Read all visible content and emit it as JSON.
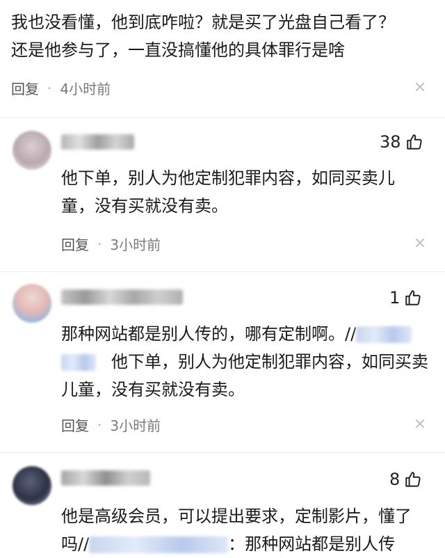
{
  "top_comment": {
    "text_line1": "我也没看懂，他到底咋啦？就是买了光盘自己看了？",
    "text_line2": "还是他参与了，一直没搞懂他的具体罪行是啥",
    "reply_label": "回复",
    "time": "4小时前"
  },
  "comments": [
    {
      "likes": "38",
      "text": "他下单，别人为他定制犯罪内容，如同买卖儿童，没有买就没有卖。",
      "reply_label": "回复",
      "time": "3小时前"
    },
    {
      "likes": "1",
      "text_part1": "那种网站都是别人传的，哪有定制啊。//",
      "text_part2": "他下单，别人为他定制犯罪内容，如同买卖儿童，没有买就没有卖。",
      "reply_label": "回复",
      "time": "3小时前"
    },
    {
      "likes": "8",
      "text_part1": "他是高级会员，可以提出要求，定制影片，懂了吗//",
      "text_part2": "：那种网站都是别人传"
    }
  ],
  "icons": {
    "like": "thumbs-up-icon",
    "close": "close-icon"
  },
  "colors": {
    "meta_text": "#7a7a7a",
    "mention_blur": "#c9d6f0"
  }
}
